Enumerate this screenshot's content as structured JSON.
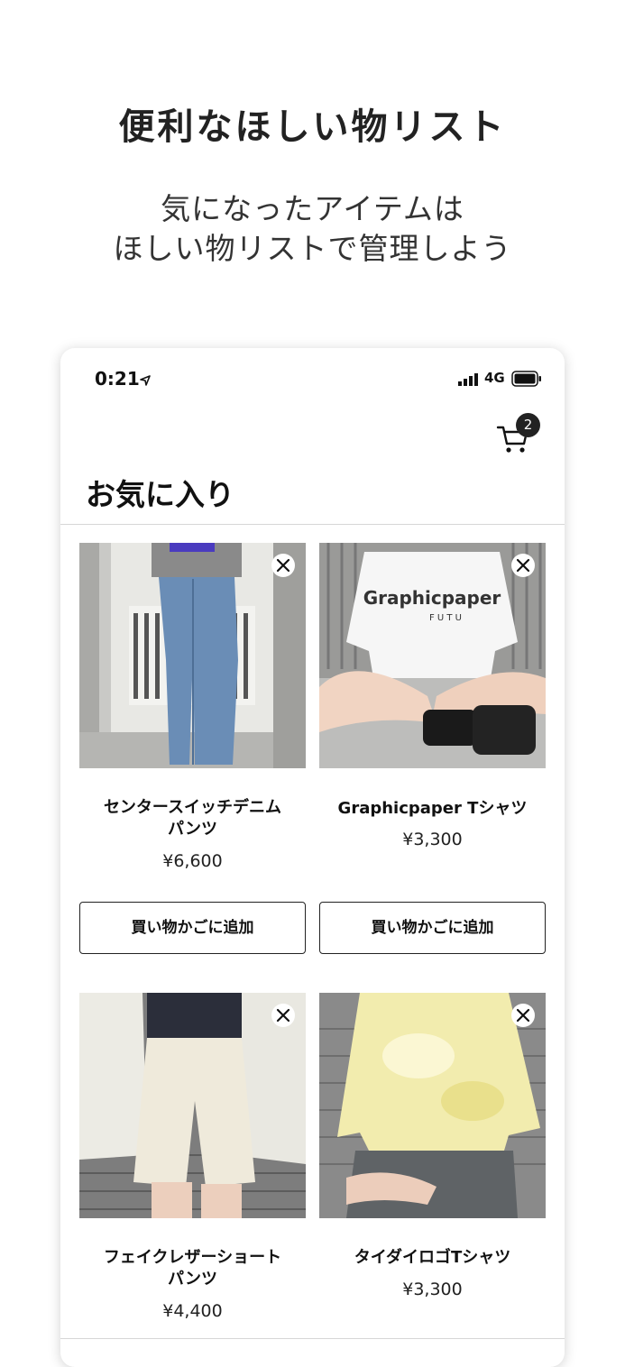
{
  "promo": {
    "headline": "便利なほしい物リスト",
    "subline": "気になったアイテムは\nほしい物リストで管理しよう"
  },
  "status_bar": {
    "time": "0:21",
    "network": "4G",
    "icons": [
      "location-arrow-icon",
      "signal-bars-icon",
      "battery-icon"
    ]
  },
  "header": {
    "cart_count": "2",
    "title": "お気に入り"
  },
  "items": [
    {
      "name": "センタースイッチデニム\nパンツ",
      "price": "¥6,600",
      "button": "買い物かごに追加",
      "photo": "denim-pants-photo"
    },
    {
      "name": "Graphicpaper Tシャツ",
      "price": "¥3,300",
      "button": "買い物かごに追加",
      "photo": "white-tshirt-photo",
      "print": "Graphicpaper",
      "print_sub": "F U T U"
    },
    {
      "name": "フェイクレザーショート\nパンツ",
      "price": "¥4,400",
      "photo": "leather-shorts-photo"
    },
    {
      "name": "タイダイロゴTシャツ",
      "price": "¥3,300",
      "photo": "tiedye-tshirt-photo"
    }
  ],
  "colors": {
    "text": "#222222",
    "border": "#222222",
    "divider": "#d6d6d6"
  }
}
